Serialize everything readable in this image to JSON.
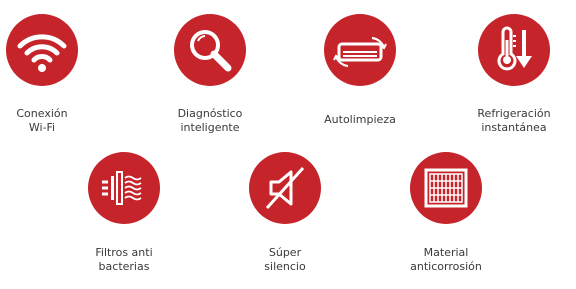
{
  "features": [
    {
      "id": "wifi",
      "icon": "wifi-icon",
      "label": "Conexión\nWi-Fi"
    },
    {
      "id": "diagnostico",
      "icon": "magnifier-icon",
      "label": "Diagnóstico\ninteligente"
    },
    {
      "id": "autolimpieza",
      "icon": "ac-unit-cycle-icon",
      "label": "Autolimpieza"
    },
    {
      "id": "refrigeracion",
      "icon": "thermometer-down-icon",
      "label": "Refrigeración\ninstantánea"
    },
    {
      "id": "filtros",
      "icon": "filter-airflow-icon",
      "label": "Filtros anti\nbacterias"
    },
    {
      "id": "silencio",
      "icon": "mute-speaker-icon",
      "label": "Súper\nsilencio"
    },
    {
      "id": "material",
      "icon": "corrosion-grid-icon",
      "label": "Material\nanticorrosión"
    }
  ],
  "colors": {
    "accent": "#c5242a",
    "icon": "#ffffff",
    "text": "#3a3a3a"
  }
}
